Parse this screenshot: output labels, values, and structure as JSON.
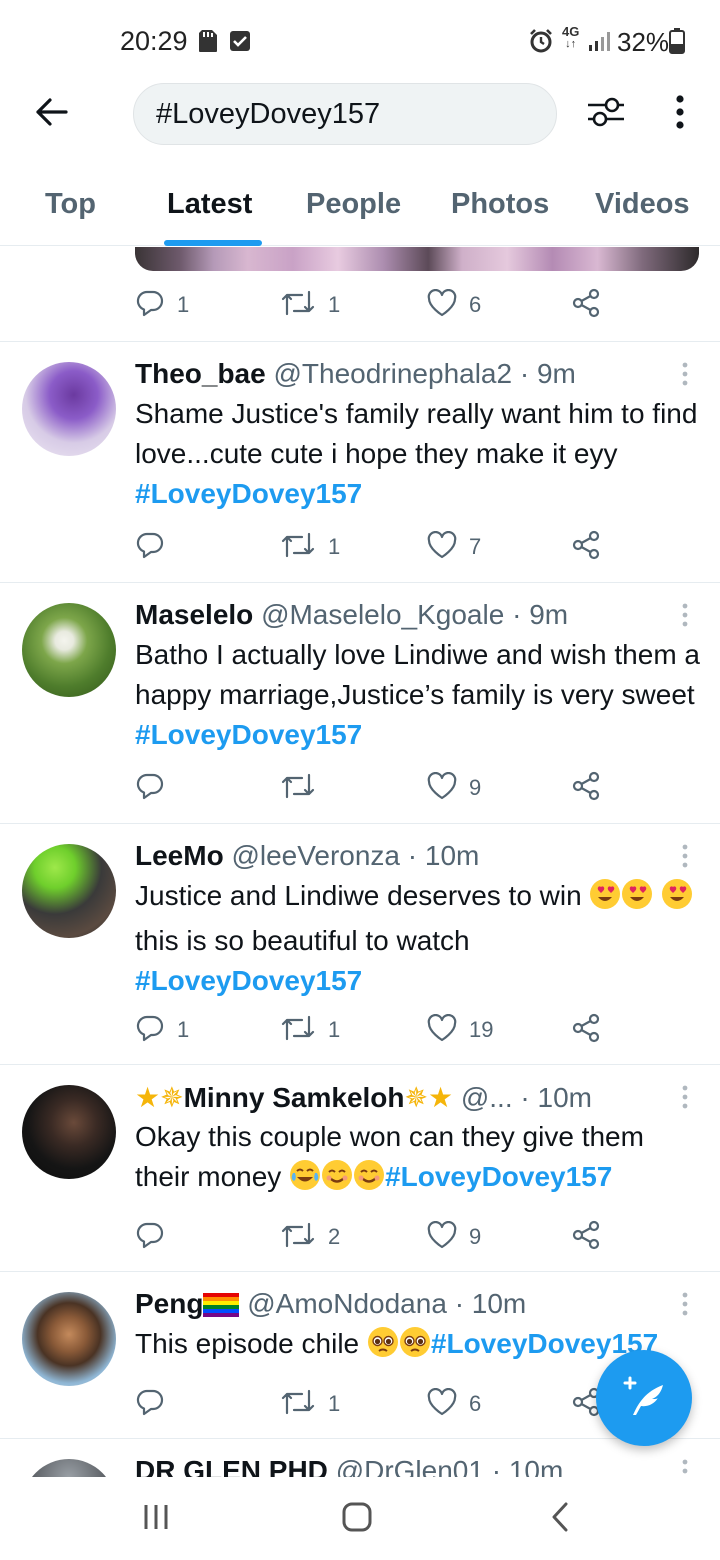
{
  "status_bar": {
    "time": "20:29",
    "battery_percent": "32%",
    "network": "4G",
    "icons": [
      "sd-card-icon",
      "checkbox-notification-icon",
      "alarm-icon",
      "signal-icon",
      "battery-icon"
    ]
  },
  "header": {
    "search_query": "#LoveyDovey157",
    "icons": [
      "back-arrow-icon",
      "filter-sliders-icon",
      "more-vertical-icon"
    ]
  },
  "tabs": [
    {
      "label": "Top",
      "active": false
    },
    {
      "label": "Latest",
      "active": true
    },
    {
      "label": "People",
      "active": false
    },
    {
      "label": "Photos",
      "active": false
    },
    {
      "label": "Videos",
      "active": false
    }
  ],
  "colors": {
    "accent": "#1d9bf0",
    "text_primary": "#0f1419",
    "text_secondary": "#536471",
    "divider": "#e6ecf0"
  },
  "previous_tweet_actions": {
    "replies": "1",
    "retweets": "1",
    "likes": "6"
  },
  "tweets": [
    {
      "name": "Theo_bae",
      "handle": "@Theodrinephala2",
      "time": "· 9m",
      "text": "Shame Justice's family really want him to find love...cute cute i hope they make it eyy",
      "hashtag": "#LoveyDovey157",
      "replies": "",
      "retweets": "1",
      "likes": "7"
    },
    {
      "name": "Maselelo",
      "handle": "@Maselelo_Kgoale",
      "time": "· 9m",
      "text": "Batho I actually love Lindiwe and wish them a happy marriage,Justice’s family is very sweet",
      "hashtag": "#LoveyDovey157",
      "replies": "",
      "retweets": "",
      "likes": "9"
    },
    {
      "name": "LeeMo",
      "handle": "@leeVeronza",
      "time": "· 10m",
      "text_a": "Justice and Lindiwe deserves to win",
      "text_b": "this is so beautiful to watch",
      "hashtag": "#LoveyDovey157",
      "replies": "1",
      "retweets": "1",
      "likes": "19"
    },
    {
      "name": "Minny Samkeloh",
      "handle": "@...",
      "time": "· 10m",
      "text": "Okay this couple won can they give them their money",
      "hashtag": "#LoveyDovey157",
      "replies": "",
      "retweets": "2",
      "likes": "9"
    },
    {
      "name": "Peng",
      "handle": "@AmoNdodana",
      "time": "· 10m",
      "text": "This episode chile",
      "hashtag": "#LoveyDovey157",
      "replies": "",
      "retweets": "1",
      "likes": "6"
    },
    {
      "name": "DR GLEN PHD",
      "handle": "@DrGlen01",
      "time": "· 10m"
    }
  ],
  "compose_button_icon": "compose-feather-plus-icon",
  "nav_icons": [
    "recent-apps-icon",
    "home-icon",
    "back-icon"
  ]
}
